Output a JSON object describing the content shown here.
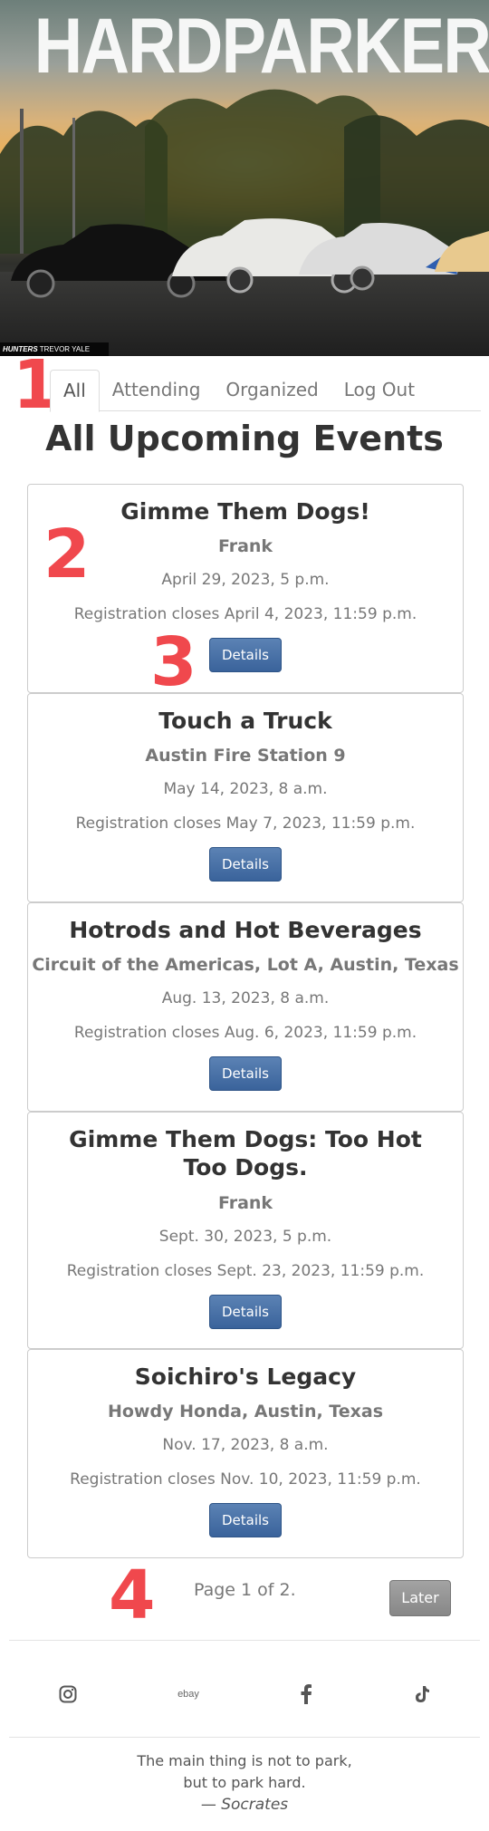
{
  "hero": {
    "title": "HARDPARKERS",
    "credit_brand": "HUNTERS",
    "credit_name": "TREVOR YALE RYAN"
  },
  "annotations": [
    "1",
    "2",
    "3",
    "4"
  ],
  "tabs": [
    {
      "label": "All",
      "active": true
    },
    {
      "label": "Attending",
      "active": false
    },
    {
      "label": "Organized",
      "active": false
    },
    {
      "label": "Log Out",
      "active": false
    }
  ],
  "page_title": "All Upcoming Events",
  "events": [
    {
      "title": "Gimme Them Dogs!",
      "location": "Frank",
      "date": "April 29, 2023, 5 p.m.",
      "registration": "Registration closes April 4, 2023, 11:59 p.m.",
      "button": "Details"
    },
    {
      "title": "Touch a Truck",
      "location": "Austin Fire Station 9",
      "date": "May 14, 2023, 8 a.m.",
      "registration": "Registration closes May 7, 2023, 11:59 p.m.",
      "button": "Details"
    },
    {
      "title": "Hotrods and Hot Beverages",
      "location": "Circuit of the Americas, Lot A, Austin, Texas",
      "date": "Aug. 13, 2023, 8 a.m.",
      "registration": "Registration closes Aug. 6, 2023, 11:59 p.m.",
      "button": "Details"
    },
    {
      "title": "Gimme Them Dogs: Too Hot Too Dogs.",
      "location": "Frank",
      "date": "Sept. 30, 2023, 5 p.m.",
      "registration": "Registration closes Sept. 23, 2023, 11:59 p.m.",
      "button": "Details"
    },
    {
      "title": "Soichiro's Legacy",
      "location": "Howdy Honda, Austin, Texas",
      "date": "Nov. 17, 2023, 8 a.m.",
      "registration": "Registration closes Nov. 10, 2023, 11:59 p.m.",
      "button": "Details"
    }
  ],
  "pagination": {
    "info": "Page 1 of 2.",
    "next_label": "Later"
  },
  "footer": {
    "social": [
      {
        "name": "instagram-icon"
      },
      {
        "name": "ebay-icon",
        "text": "ebay"
      },
      {
        "name": "facebook-icon"
      },
      {
        "name": "tiktok-icon"
      }
    ],
    "quote_line1": "The main thing is not to park,",
    "quote_line2": "but to park hard.",
    "quote_author": "— Socrates"
  }
}
